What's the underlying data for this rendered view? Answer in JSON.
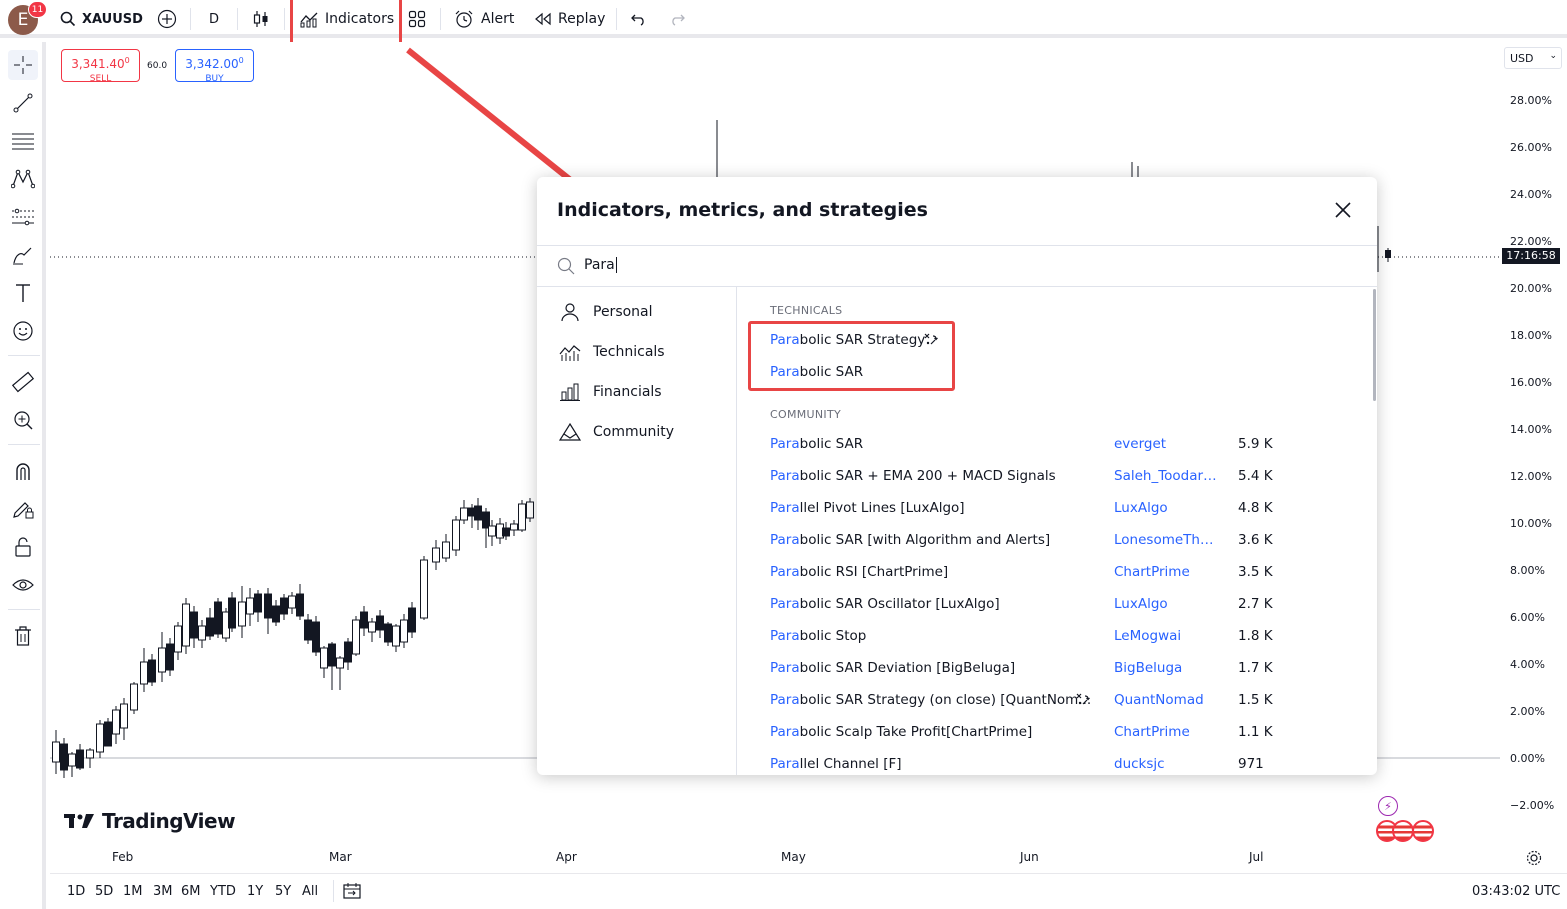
{
  "topbar": {
    "avatar_letter": "E",
    "notification_count": "11",
    "symbol": "XAUUSD",
    "interval": "D",
    "indicators_label": "Indicators",
    "alert_label": "Alert",
    "replay_label": "Replay"
  },
  "trade": {
    "sell_price": "3,341.40",
    "sell_price_sup": "0",
    "sell_label": "SELL",
    "spread": "60.0",
    "buy_price": "3,342.00",
    "buy_price_sup": "0",
    "buy_label": "BUY"
  },
  "price_axis": {
    "currency": "USD",
    "labels": [
      "28.00%",
      "26.00%",
      "24.00%",
      "22.00%",
      "20.00%",
      "18.00%",
      "16.00%",
      "14.00%",
      "12.00%",
      "10.00%",
      "8.00%",
      "6.00%",
      "4.00%",
      "2.00%",
      "0.00%",
      "−2.00%"
    ],
    "countdown": "17:16:58"
  },
  "time_axis": {
    "labels": [
      "Feb",
      "Mar",
      "Apr",
      "May",
      "Jun",
      "Jul"
    ]
  },
  "bottombar": {
    "ranges": [
      "1D",
      "5D",
      "1M",
      "3M",
      "6M",
      "YTD",
      "1Y",
      "5Y",
      "All"
    ],
    "clock": "03:43:02 UTC"
  },
  "branding": {
    "logo_text": "TradingView"
  },
  "modal": {
    "title": "Indicators, metrics, and strategies",
    "search_value": "Para",
    "sidebar": [
      {
        "label": "Personal",
        "icon": "person-icon"
      },
      {
        "label": "Technicals",
        "icon": "technicals-icon"
      },
      {
        "label": "Financials",
        "icon": "financials-icon"
      },
      {
        "label": "Community",
        "icon": "community-icon"
      }
    ],
    "technicals_header": "TECHNICALS",
    "technicals": [
      {
        "match": "Para",
        "rest": "bolic SAR Strategy",
        "strategy": true
      },
      {
        "match": "Para",
        "rest": "bolic SAR",
        "strategy": false
      }
    ],
    "community_header": "COMMUNITY",
    "community": [
      {
        "match": "Para",
        "rest": "bolic SAR",
        "author": "everget",
        "count": "5.9 K",
        "strategy": false
      },
      {
        "match": "Para",
        "rest": "bolic SAR + EMA 200 + MACD Signals",
        "author": "Saleh_Toodarv...",
        "count": "5.4 K",
        "strategy": false
      },
      {
        "match": "Para",
        "rest": "llel Pivot Lines [LuxAlgo]",
        "author": "LuxAlgo",
        "count": "4.8 K",
        "strategy": false
      },
      {
        "match": "Para",
        "rest": "bolic SAR [with Algorithm and Alerts]",
        "author": "LonesomeThe...",
        "count": "3.6 K",
        "strategy": false
      },
      {
        "match": "Para",
        "rest": "bolic RSI [ChartPrime]",
        "author": "ChartPrime",
        "count": "3.5 K",
        "strategy": false
      },
      {
        "match": "Para",
        "rest": "bolic SAR Oscillator [LuxAlgo]",
        "author": "LuxAlgo",
        "count": "2.7 K",
        "strategy": false
      },
      {
        "match": "Para",
        "rest": "bolic Stop",
        "author": "LeMogwai",
        "count": "1.8 K",
        "strategy": false
      },
      {
        "match": "Para",
        "rest": "bolic SAR Deviation [BigBeluga]",
        "author": "BigBeluga",
        "count": "1.7 K",
        "strategy": false
      },
      {
        "match": "Para",
        "rest": "bolic SAR Strategy (on close) [QuantNom...",
        "author": "QuantNomad",
        "count": "1.5 K",
        "strategy": true
      },
      {
        "match": "Para",
        "rest": "bolic Scalp Take Profit[ChartPrime]",
        "author": "ChartPrime",
        "count": "1.1 K",
        "strategy": false
      },
      {
        "match": "Para",
        "rest": "llel Channel [F]",
        "author": "ducksjc",
        "count": "971",
        "strategy": false
      }
    ]
  },
  "colors": {
    "accent": "#2962ff",
    "sell": "#f23645",
    "highlight": "#e84545"
  }
}
